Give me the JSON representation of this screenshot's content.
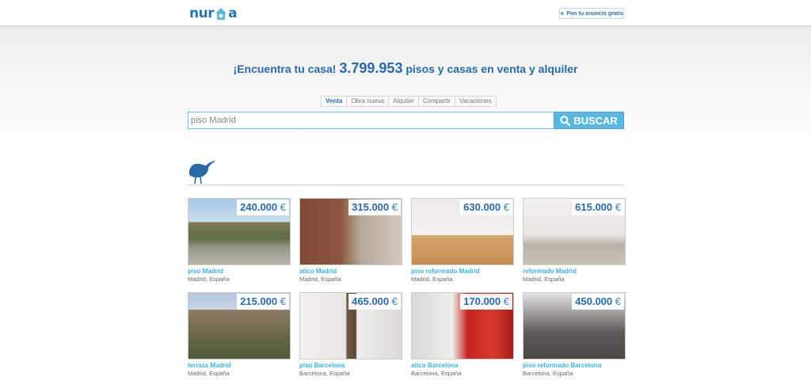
{
  "header": {
    "logo_text_left": "nur",
    "logo_text_right": "a",
    "publish_label": "Pon tu anuncio gratis"
  },
  "hero": {
    "headline_pre": "¡Encuentra tu casa! ",
    "headline_count": "3.799.953",
    "headline_post": " pisos y casas en venta y alquiler"
  },
  "tabs": [
    {
      "label": "Venta",
      "active": true
    },
    {
      "label": "Obra nueva",
      "active": false
    },
    {
      "label": "Alquiler",
      "active": false
    },
    {
      "label": "Compartir",
      "active": false
    },
    {
      "label": "Vacaciones",
      "active": false
    }
  ],
  "search": {
    "value": "piso Madrid",
    "button_label": "BUSCAR"
  },
  "colors": {
    "brand": "#2a73b5",
    "accent": "#5ab7e0",
    "link": "#3cb0e0"
  },
  "listings": [
    {
      "price": "240.000",
      "currency": "€",
      "title": "piso Madrid",
      "location": "Madrid, España"
    },
    {
      "price": "315.000",
      "currency": "€",
      "title": "atico Madrid",
      "location": "Madrid, España"
    },
    {
      "price": "630.000",
      "currency": "€",
      "title": "piso reformado Madrid",
      "location": "Madrid, España"
    },
    {
      "price": "615.000",
      "currency": "€",
      "title": "reformado Madrid",
      "location": "Madrid, España"
    },
    {
      "price": "215.000",
      "currency": "€",
      "title": "terraza Madrid",
      "location": "Madrid, España"
    },
    {
      "price": "465.000",
      "currency": "€",
      "title": "piso Barcelona",
      "location": "Barcelona, España"
    },
    {
      "price": "170.000",
      "currency": "€",
      "title": "atico Barcelona",
      "location": "Barcelona, España"
    },
    {
      "price": "450.000",
      "currency": "€",
      "title": "piso reformado Barcelona",
      "location": "Barcelona, España"
    }
  ]
}
